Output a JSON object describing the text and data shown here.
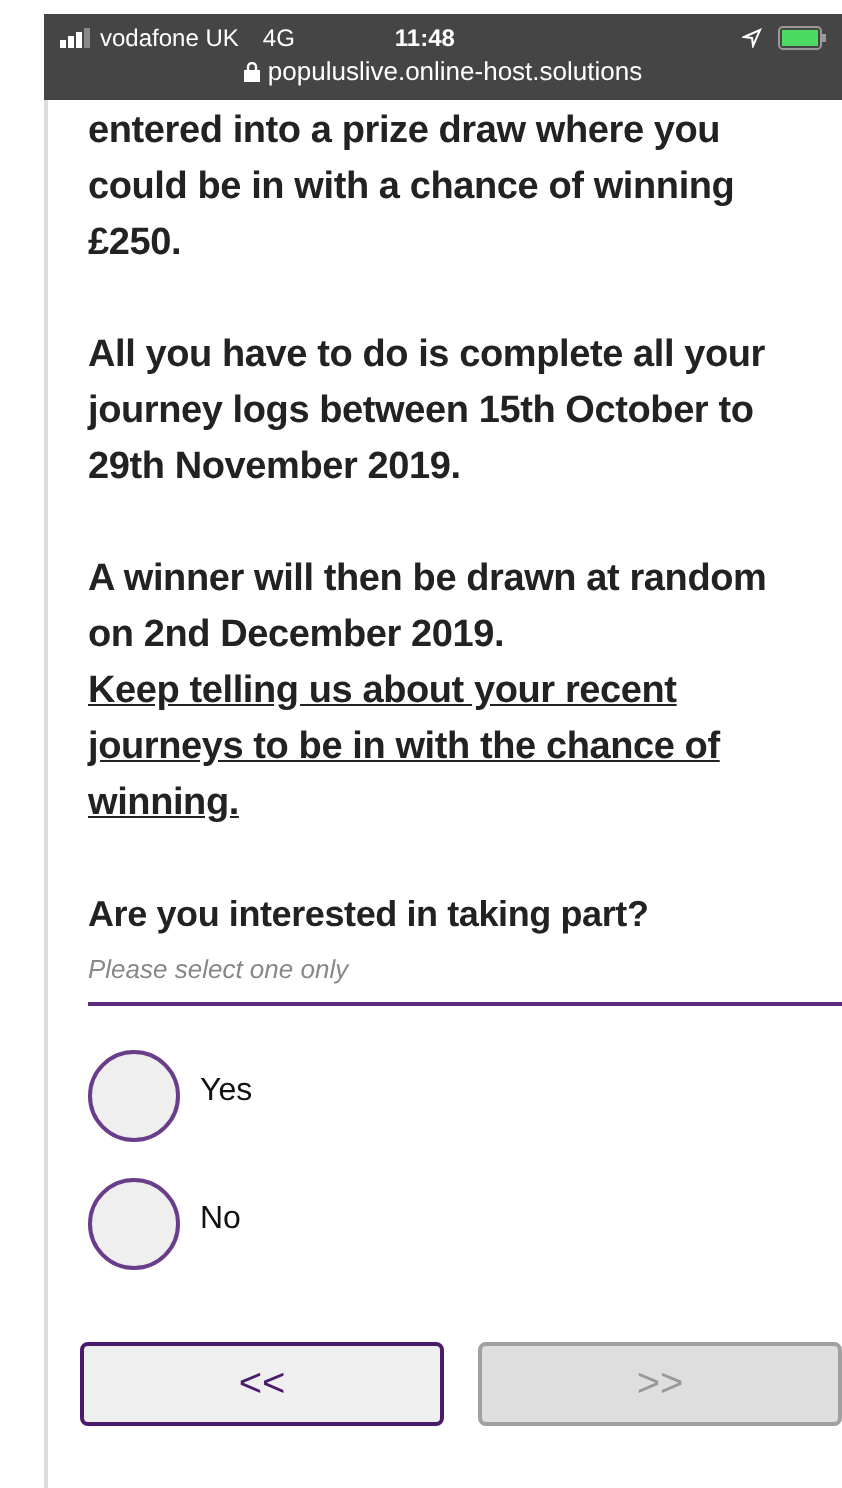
{
  "status_bar": {
    "carrier": "vodafone UK",
    "network": "4G",
    "time": "11:48",
    "url": "populuslive.online-host.solutions"
  },
  "paragraphs": [
    {
      "text": "entered into a prize draw where you could be in with a chance of winning £250.",
      "underlined": false
    },
    {
      "text": "All you have to do is complete all your journey logs between 15th October to 29th November 2019.",
      "underlined": false
    },
    {
      "text": "A winner will then be drawn at random on 2nd December 2019.",
      "underlined": false
    },
    {
      "text": "Keep telling us about your recent journeys to be in with the chance of winning.",
      "underlined": true
    }
  ],
  "question": {
    "text": "Are you interested in taking part?",
    "hint": "Please select one only"
  },
  "options": [
    {
      "label": "Yes",
      "selected": false
    },
    {
      "label": "No",
      "selected": false
    }
  ],
  "buttons": [
    {
      "label": "<<",
      "disabled": false
    },
    {
      "label": ">>",
      "disabled": true
    }
  ]
}
